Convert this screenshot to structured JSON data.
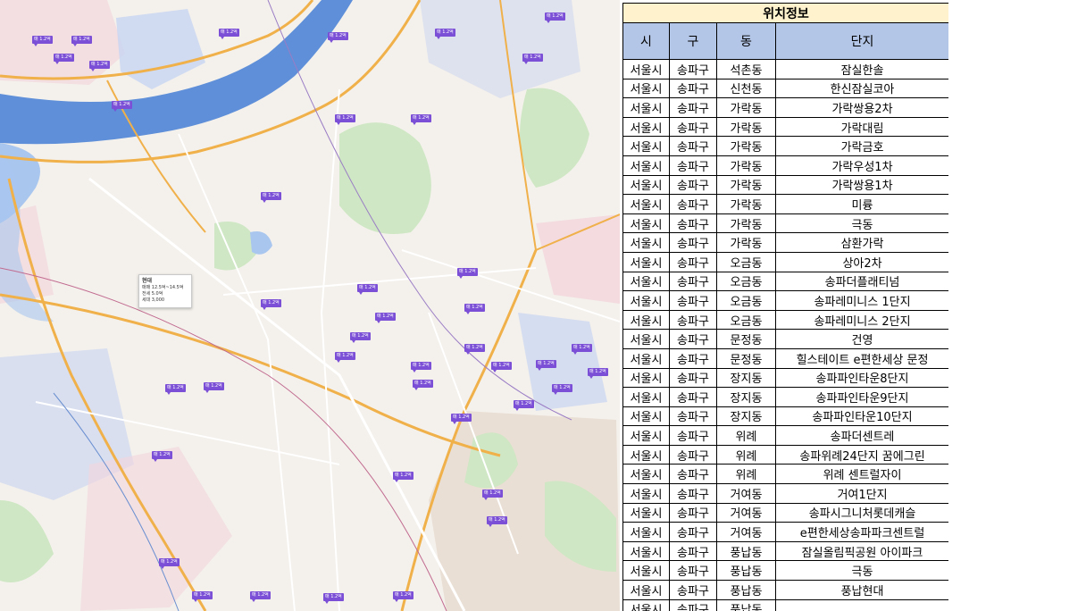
{
  "table": {
    "title": "위치정보",
    "headers": [
      "시",
      "구",
      "동",
      "단지"
    ],
    "rows": [
      [
        "서울시",
        "송파구",
        "석촌동",
        "잠실한솔"
      ],
      [
        "서울시",
        "송파구",
        "신천동",
        "한신잠실코아"
      ],
      [
        "서울시",
        "송파구",
        "가락동",
        "가락쌍용2차"
      ],
      [
        "서울시",
        "송파구",
        "가락동",
        "가락대림"
      ],
      [
        "서울시",
        "송파구",
        "가락동",
        "가락금호"
      ],
      [
        "서울시",
        "송파구",
        "가락동",
        "가락우성1차"
      ],
      [
        "서울시",
        "송파구",
        "가락동",
        "가락쌍용1차"
      ],
      [
        "서울시",
        "송파구",
        "가락동",
        "미륭"
      ],
      [
        "서울시",
        "송파구",
        "가락동",
        "극동"
      ],
      [
        "서울시",
        "송파구",
        "가락동",
        "삼환가락"
      ],
      [
        "서울시",
        "송파구",
        "오금동",
        "상아2차"
      ],
      [
        "서울시",
        "송파구",
        "오금동",
        "송파더플래티넘"
      ],
      [
        "서울시",
        "송파구",
        "오금동",
        "송파레미니스 1단지"
      ],
      [
        "서울시",
        "송파구",
        "오금동",
        "송파레미니스 2단지"
      ],
      [
        "서울시",
        "송파구",
        "문정동",
        "건영"
      ],
      [
        "서울시",
        "송파구",
        "문정동",
        "힐스테이트 e편한세상 문정"
      ],
      [
        "서울시",
        "송파구",
        "장지동",
        "송파파인타운8단지"
      ],
      [
        "서울시",
        "송파구",
        "장지동",
        "송파파인타운9단지"
      ],
      [
        "서울시",
        "송파구",
        "장지동",
        "송파파인타운10단지"
      ],
      [
        "서울시",
        "송파구",
        "위례",
        "송파더센트레"
      ],
      [
        "서울시",
        "송파구",
        "위례",
        "송파위례24단지 꿈에그린"
      ],
      [
        "서울시",
        "송파구",
        "위례",
        "위례 센트럴자이"
      ],
      [
        "서울시",
        "송파구",
        "거여동",
        "거여1단지"
      ],
      [
        "서울시",
        "송파구",
        "거여동",
        "송파시그니처롯데캐슬"
      ],
      [
        "서울시",
        "송파구",
        "거여동",
        "e편한세상송파파크센트럴"
      ],
      [
        "서울시",
        "송파구",
        "풍납동",
        "잠실올림픽공원 아이파크"
      ],
      [
        "서울시",
        "송파구",
        "풍납동",
        "극동"
      ],
      [
        "서울시",
        "송파구",
        "풍납동",
        "풍납현대"
      ],
      [
        "서울시",
        "송파구",
        "풍납동",
        ""
      ]
    ]
  },
  "map": {
    "pin_label": "매 1.2억",
    "tooltip": {
      "title": "현대",
      "line1": "매매 12.5억~14.5억",
      "line2": "전세 5.0억",
      "line3": "세대 3,000"
    },
    "colors": {
      "river": "#5e8fd8",
      "river_light": "#a9c6ef",
      "park": "#cfe7c4",
      "road_major": "#f0b04a",
      "road_minor": "#ffffff",
      "pin": "#7b4fd6",
      "district_blue": "#c7d4f2",
      "district_pink": "#f2d6dd"
    }
  }
}
